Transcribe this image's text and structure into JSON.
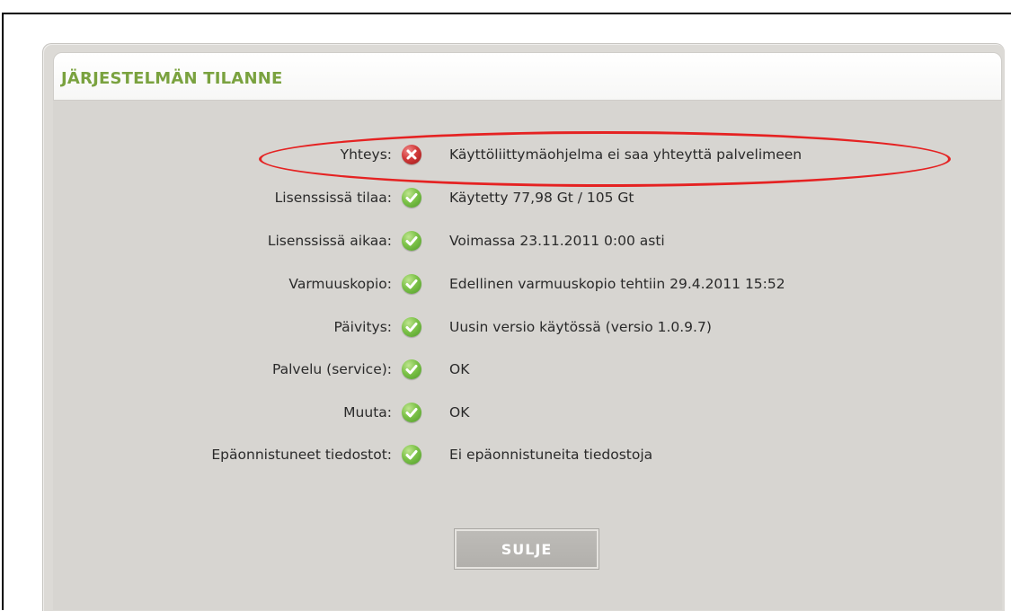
{
  "dialog": {
    "title": "JÄRJESTELMÄN TILANNE",
    "close_label": "SULJE"
  },
  "colors": {
    "title_green": "#7aa23f",
    "ok_green": "#6cb63a",
    "error_red": "#d23a3a",
    "highlight_red": "#e52222"
  },
  "status_rows": [
    {
      "label": "Yhteys:",
      "status": "error",
      "status_icon": "error-x-icon",
      "value": "Käyttöliittymäohjelma ei saa yhteyttä palvelimeen"
    },
    {
      "label": "Lisenssissä tilaa:",
      "status": "ok",
      "status_icon": "check-icon",
      "value": "Käytetty 77,98 Gt / 105 Gt"
    },
    {
      "label": "Lisenssissä aikaa:",
      "status": "ok",
      "status_icon": "check-icon",
      "value": "Voimassa 23.11.2011 0:00 asti"
    },
    {
      "label": "Varmuuskopio:",
      "status": "ok",
      "status_icon": "check-icon",
      "value": "Edellinen varmuuskopio tehtiin 29.4.2011 15:52"
    },
    {
      "label": "Päivitys:",
      "status": "ok",
      "status_icon": "check-icon",
      "value": "Uusin versio käytössä (versio 1.0.9.7)"
    },
    {
      "label": "Palvelu (service):",
      "status": "ok",
      "status_icon": "check-icon",
      "value": "OK"
    },
    {
      "label": "Muuta:",
      "status": "ok",
      "status_icon": "check-icon",
      "value": "OK"
    },
    {
      "label": "Epäonnistuneet tiedostot:",
      "status": "ok",
      "status_icon": "check-icon",
      "value": "Ei epäonnistuneita tiedostoja"
    }
  ]
}
